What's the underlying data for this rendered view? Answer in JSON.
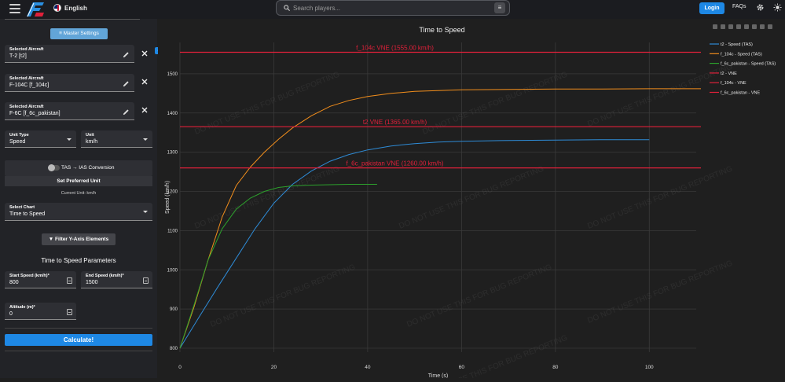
{
  "header": {
    "language": "English",
    "search_placeholder": "Search players...",
    "login_label": "Login",
    "faqs_label": "FAQs"
  },
  "sidebar": {
    "master_settings_label": "Master Settings",
    "aircraft": [
      {
        "label": "Selected Aircraft",
        "value": "T-2 [t2]"
      },
      {
        "label": "Selected Aircraft",
        "value": "F-104C [f_104c]"
      },
      {
        "label": "Selected Aircraft",
        "value": "F-6C [f_6c_pakistan]"
      }
    ],
    "unit_type": {
      "label": "Unit Type",
      "value": "Speed"
    },
    "unit": {
      "label": "Unit",
      "value": "km/h"
    },
    "tas_toggle_label": "TAS → IAS Conversion",
    "set_preferred_unit_label": "Set Preferred Unit",
    "current_unit_text": "Current Unit: km/h",
    "select_chart": {
      "label": "Select Chart",
      "value": "Time to Speed"
    },
    "filter_button_label": "Filter Y-Axis Elements",
    "params_title": "Time to Speed Parameters",
    "start_speed": {
      "label": "Start Speed (km/h)*",
      "value": "800"
    },
    "end_speed": {
      "label": "End Speed (km/h)*",
      "value": "1500"
    },
    "altitude": {
      "label": "Altitude (m)*",
      "value": "0"
    },
    "calculate_label": "Calculate!"
  },
  "chart_data": {
    "type": "line",
    "title": "Time to Speed",
    "xlabel": "Time (s)",
    "ylabel": "Speed (km/h)",
    "xlim": [
      0,
      110
    ],
    "ylim": [
      790,
      1580
    ],
    "xticks": [
      0,
      20,
      40,
      60,
      80,
      100
    ],
    "yticks": [
      800,
      900,
      1000,
      1100,
      1200,
      1300,
      1400,
      1500
    ],
    "grid": true,
    "legend_position": "right",
    "watermark": "DO NOT USE THIS FOR BUG REPORTING",
    "series": [
      {
        "name": "t2 - Speed (TAS)",
        "color": "#2e8bd6",
        "x": [
          0,
          4,
          8,
          12,
          16,
          20,
          24,
          28,
          32,
          36,
          40,
          45,
          50,
          55,
          60,
          70,
          80,
          90,
          100
        ],
        "y": [
          800,
          878,
          955,
          1030,
          1105,
          1170,
          1218,
          1252,
          1277,
          1294,
          1306,
          1316,
          1322,
          1326,
          1328,
          1330,
          1331,
          1332,
          1332
        ]
      },
      {
        "name": "f_104c - Speed (TAS)",
        "color": "#f28e1c",
        "x": [
          0,
          3,
          6,
          9,
          12,
          15,
          18,
          21,
          24,
          28,
          32,
          36,
          40,
          45,
          50,
          55,
          60,
          70,
          80,
          90,
          100,
          111
        ],
        "y": [
          800,
          905,
          1025,
          1135,
          1215,
          1262,
          1300,
          1333,
          1362,
          1393,
          1417,
          1432,
          1442,
          1450,
          1455,
          1457,
          1459,
          1460,
          1461,
          1461,
          1462,
          1462
        ]
      },
      {
        "name": "f_6c_pakistan - Speed (TAS)",
        "color": "#2ca02c",
        "x": [
          0,
          3,
          6,
          9,
          12,
          15,
          18,
          21,
          24,
          28,
          32,
          36,
          40,
          42
        ],
        "y": [
          800,
          910,
          1025,
          1105,
          1155,
          1183,
          1200,
          1210,
          1214,
          1216,
          1217,
          1218,
          1218,
          1218
        ]
      },
      {
        "name": "t2 - VNE",
        "color": "#e0203a",
        "x": [
          0,
          111
        ],
        "y": [
          1365,
          1365
        ],
        "label": "t2 VNE (1365.00 km/h)"
      },
      {
        "name": "f_104c - VNE",
        "color": "#e0203a",
        "x": [
          0,
          111
        ],
        "y": [
          1555,
          1555
        ],
        "label": "f_104c VNE (1555.00 km/h)"
      },
      {
        "name": "f_6c_pakistan - VNE",
        "color": "#e0203a",
        "x": [
          0,
          111
        ],
        "y": [
          1260,
          1260
        ],
        "label": "f_6c_pakistan VNE (1260.00 km/h)"
      }
    ]
  },
  "colors": {
    "accent": "#1e88e5",
    "master_settings": "#62a5d8",
    "vne_line": "#e0203a"
  }
}
